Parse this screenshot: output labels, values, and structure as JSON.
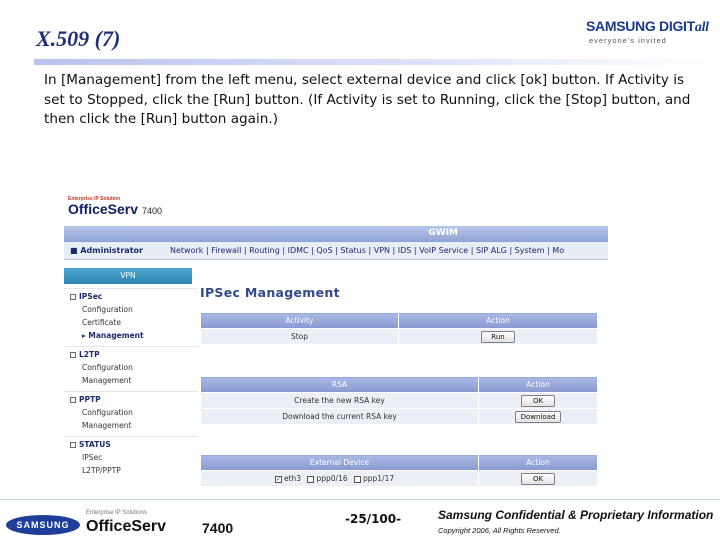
{
  "slide": {
    "title": "X.509 (7)",
    "instructions": "In [Management] from the left menu, select external device and click [ok] button. If Activity is set to Stopped, click the [Run] button. (If Activity is set to Running, click the [Stop] button, and then click the [Run] button again.)"
  },
  "logo": {
    "brand_main": "SAMSUNG DIGIT",
    "brand_tail": "all",
    "tagline": "everyone's invited"
  },
  "app": {
    "brand_small": "Enterprise IP Solution",
    "brand_main": "OfficeServ",
    "brand_model": "7400",
    "band_title": "GWIM",
    "admin": "Administrator",
    "menu": "Network | Firewall | Routing | IDMC | QoS | Status | VPN | IDS | VoIP Service | SIP ALG | System | Mo",
    "sidebar": {
      "header": "VPN",
      "sections": [
        {
          "label": "IPSec",
          "items": [
            "Configuration",
            "Certificate",
            "Management"
          ]
        },
        {
          "label": "L2TP",
          "items": [
            "Configuration",
            "Management"
          ]
        },
        {
          "label": "PPTP",
          "items": [
            "Configuration",
            "Management"
          ]
        },
        {
          "label": "STATUS",
          "items": [
            "IPSec",
            "L2TP/PPTP"
          ]
        }
      ]
    },
    "content_title": "IPSec Management",
    "activity_table": {
      "headers": [
        "Activity",
        "Action"
      ],
      "row": {
        "status": "Stop",
        "button": "Run"
      }
    },
    "rsa_table": {
      "headers": [
        "RSA",
        "Action"
      ],
      "rows": [
        {
          "label": "Create the new RSA key",
          "button": "OK"
        },
        {
          "label": "Download the current RSA key",
          "button": "Download"
        }
      ]
    },
    "device_table": {
      "headers": [
        "External Device",
        "Action"
      ],
      "options": [
        "eth3",
        "ppp0/16",
        "ppp1/17"
      ],
      "checked_index": 0,
      "button": "OK"
    }
  },
  "footer": {
    "samsung": "SAMSUNG",
    "product_caption": "Enterprise IP Solutions",
    "product": "OfficeServ",
    "model": "7400",
    "page": "-25/100-",
    "confidential": "Samsung Confidential & Proprietary Information",
    "copyright": "Copyright 2006, All Rights Reserved."
  }
}
